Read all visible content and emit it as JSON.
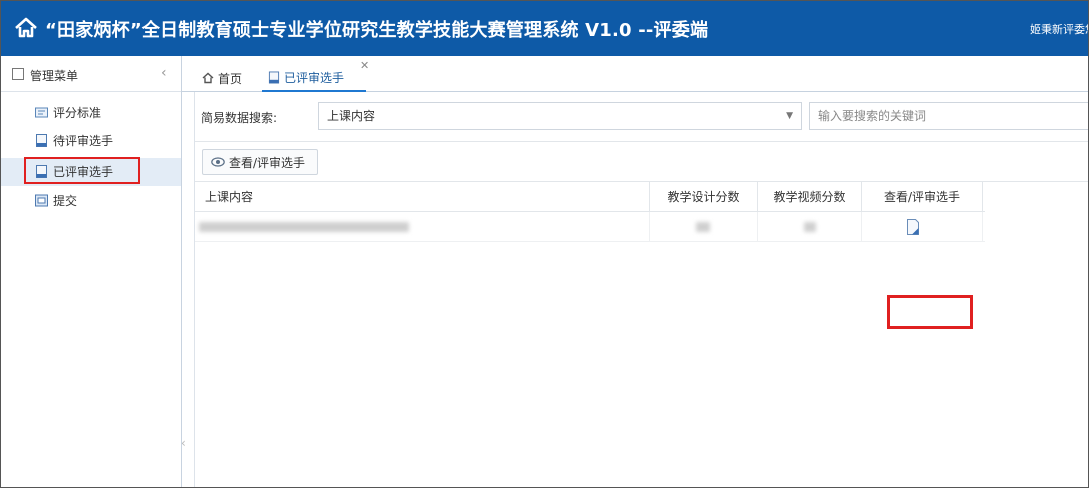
{
  "header": {
    "title": "“田家炳杯”全日制教育硕士专业学位研究生教学技能大赛管理系统 V1.0 --评委端",
    "user": "姬秉新评委您"
  },
  "sidebar": {
    "title": "管理菜单",
    "items": [
      {
        "label": "评分标准",
        "icon": "scoring-standard-icon"
      },
      {
        "label": "待评审选手",
        "icon": "document-icon"
      },
      {
        "label": "已评审选手",
        "icon": "document-icon",
        "active": true
      },
      {
        "label": "提交",
        "icon": "submit-icon"
      }
    ]
  },
  "tabs": [
    {
      "label": "首页",
      "icon": "home-icon"
    },
    {
      "label": "已评审选手",
      "icon": "document-icon",
      "active": true,
      "closable": true
    }
  ],
  "search": {
    "label": "简易数据搜索:",
    "field_value": "上课内容",
    "placeholder": "输入要搜索的关键词"
  },
  "toolbar": {
    "view_button_label": "查看/评审选手"
  },
  "grid": {
    "columns": [
      "上课内容",
      "教学设计分数",
      "教学视频分数",
      "查看/评审选手"
    ]
  },
  "colors": {
    "header_bg": "#0e5aa7",
    "highlight": "#e02020",
    "tab_active": "#1f78d1"
  }
}
